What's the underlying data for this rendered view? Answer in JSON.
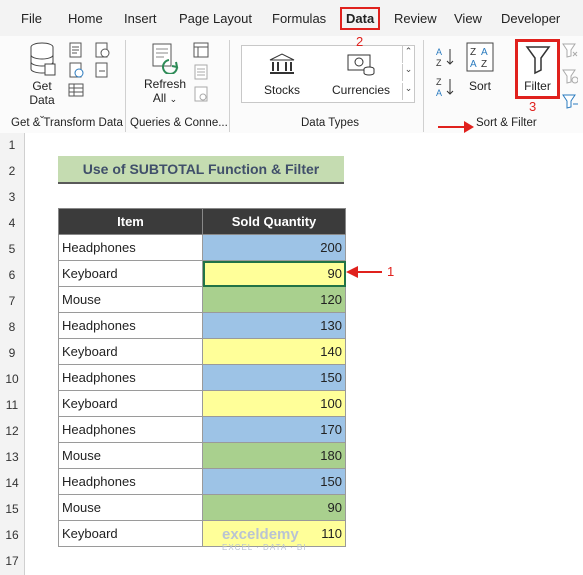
{
  "menu": {
    "items": [
      "File",
      "Home",
      "Insert",
      "Page Layout",
      "Formulas",
      "Data",
      "Review",
      "View",
      "Developer"
    ],
    "active": "Data"
  },
  "annotations": {
    "step1": "1",
    "step2": "2",
    "step3": "3"
  },
  "ribbon": {
    "get_data_label": "Get\nData",
    "get_data_line1": "Get",
    "get_data_line2": "Data",
    "refresh_line1": "Refresh",
    "refresh_line2": "All",
    "stocks_label": "Stocks",
    "currencies_label": "Currencies",
    "sort_label": "Sort",
    "filter_label": "Filter",
    "groups": {
      "get_transform": "Get & Transform Data",
      "queries": "Queries & Conne...",
      "data_types": "Data Types",
      "sort_filter": "Sort & Filter"
    }
  },
  "sheet": {
    "row_numbers": [
      "1",
      "2",
      "3",
      "4",
      "5",
      "6",
      "7",
      "8",
      "9",
      "10",
      "11",
      "12",
      "13",
      "14",
      "15",
      "16",
      "17"
    ],
    "title": "Use of SUBTOTAL Function & Filter",
    "headers": [
      "Item",
      "Sold Quantity"
    ],
    "rows": [
      {
        "item": "Headphones",
        "qty": "200",
        "color": "blue"
      },
      {
        "item": "Keyboard",
        "qty": "90",
        "color": "yellow"
      },
      {
        "item": "Mouse",
        "qty": "120",
        "color": "green"
      },
      {
        "item": "Headphones",
        "qty": "130",
        "color": "blue"
      },
      {
        "item": "Keyboard",
        "qty": "140",
        "color": "yellow"
      },
      {
        "item": "Headphones",
        "qty": "150",
        "color": "blue"
      },
      {
        "item": "Keyboard",
        "qty": "100",
        "color": "yellow"
      },
      {
        "item": "Headphones",
        "qty": "170",
        "color": "blue"
      },
      {
        "item": "Mouse",
        "qty": "180",
        "color": "green"
      },
      {
        "item": "Headphones",
        "qty": "150",
        "color": "blue"
      },
      {
        "item": "Mouse",
        "qty": "90",
        "color": "green"
      },
      {
        "item": "Keyboard",
        "qty": "110",
        "color": "yellow"
      }
    ]
  },
  "watermark": {
    "name": "exceldemy",
    "tagline": "EXCEL · DATA · BI"
  }
}
